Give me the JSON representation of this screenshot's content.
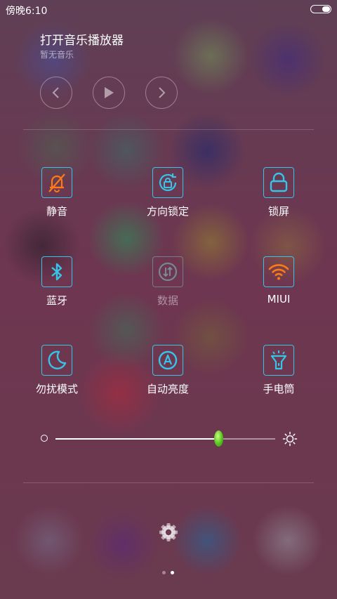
{
  "status_bar": {
    "time": "傍晚6:10",
    "battery_level": 0.45
  },
  "music": {
    "title": "打开音乐播放器",
    "subtitle": "暂无音乐",
    "controls": [
      "previous-icon",
      "play-icon",
      "next-icon"
    ]
  },
  "toggles": [
    {
      "label": "静音",
      "icon": "bell-off-icon",
      "state": "on",
      "color": "#ff7a14"
    },
    {
      "label": "方向锁定",
      "icon": "rotation-lock-icon",
      "state": "on",
      "color": "#35c5e8"
    },
    {
      "label": "锁屏",
      "icon": "lock-icon",
      "state": "on",
      "color": "#35c5e8"
    },
    {
      "label": "蓝牙",
      "icon": "bluetooth-icon",
      "state": "on",
      "color": "#35c5e8"
    },
    {
      "label": "数据",
      "icon": "mobile-data-icon",
      "state": "off",
      "color": "#7f97a4"
    },
    {
      "label": "MIUI",
      "icon": "wifi-icon",
      "state": "on",
      "color": "#ff7a14"
    },
    {
      "label": "勿扰模式",
      "icon": "moon-icon",
      "state": "on",
      "color": "#35c5e8"
    },
    {
      "label": "自动亮度",
      "icon": "auto-brightness-icon",
      "state": "on",
      "color": "#35c5e8"
    },
    {
      "label": "手电筒",
      "icon": "flashlight-icon",
      "state": "on",
      "color": "#35c5e8"
    }
  ],
  "brightness": {
    "level": 0.74,
    "min_icon": "brightness-low-icon",
    "max_icon": "brightness-high-icon"
  },
  "settings_icon": "gear-icon",
  "pager": {
    "pages": 2,
    "current": 2
  },
  "colors": {
    "accent": "#35c5e8",
    "active_orange": "#ff7a14",
    "slider_thumb": "#55c21e"
  }
}
